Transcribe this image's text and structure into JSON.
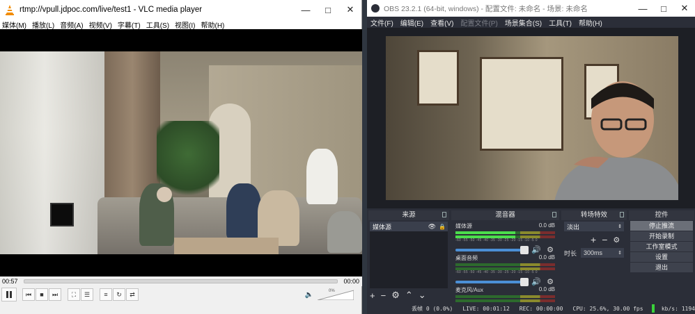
{
  "vlc": {
    "title": "rtmp://vpull.jdpoc.com/live/test1 - VLC media player",
    "menu": [
      "媒体(M)",
      "播放(L)",
      "音频(A)",
      "视频(V)",
      "字幕(T)",
      "工具(S)",
      "视图(I)",
      "帮助(H)"
    ],
    "elapsed": "00:57",
    "remaining": "00:00",
    "volume": "0%"
  },
  "obs": {
    "title": "OBS 23.2.1 (64-bit, windows) - 配置文件: 未命名 - 场景: 未命名",
    "menu": [
      "文件(F)",
      "编辑(E)",
      "查看(V)",
      "配置文件(P)",
      "场景集合(S)",
      "工具(T)",
      "帮助(H)"
    ],
    "docks": {
      "sources_title": "来源",
      "mixer_title": "混音器",
      "transitions_title": "转场特效",
      "controls_title": "控件"
    },
    "sources": [
      "媒体源"
    ],
    "mixer": [
      {
        "name": "媒体源",
        "db": "0.0 dB"
      },
      {
        "name": "桌面音频",
        "db": "0.0 dB"
      },
      {
        "name": "麦克风/Aux",
        "db": "0.0 dB"
      }
    ],
    "meter_scale": "-60 -55 -50 -45 -40 -35 -30 -25 -20 -15 -10 -5 0",
    "transition": "淡出",
    "duration_label": "时长",
    "duration_value": "300ms",
    "controls": [
      "停止推流",
      "开始录制",
      "工作室模式",
      "设置",
      "退出"
    ],
    "status": {
      "dropped": "丢帧 0 (0.0%)",
      "live": "LIVE: 00:01:12",
      "rec": "REC: 00:00:00",
      "cpu": "CPU: 25.6%, 30.00 fps",
      "kbps": "kb/s: 1194"
    },
    "colors": {
      "accent": "#4b8fd6",
      "status_ok": "#3ad13a"
    }
  }
}
